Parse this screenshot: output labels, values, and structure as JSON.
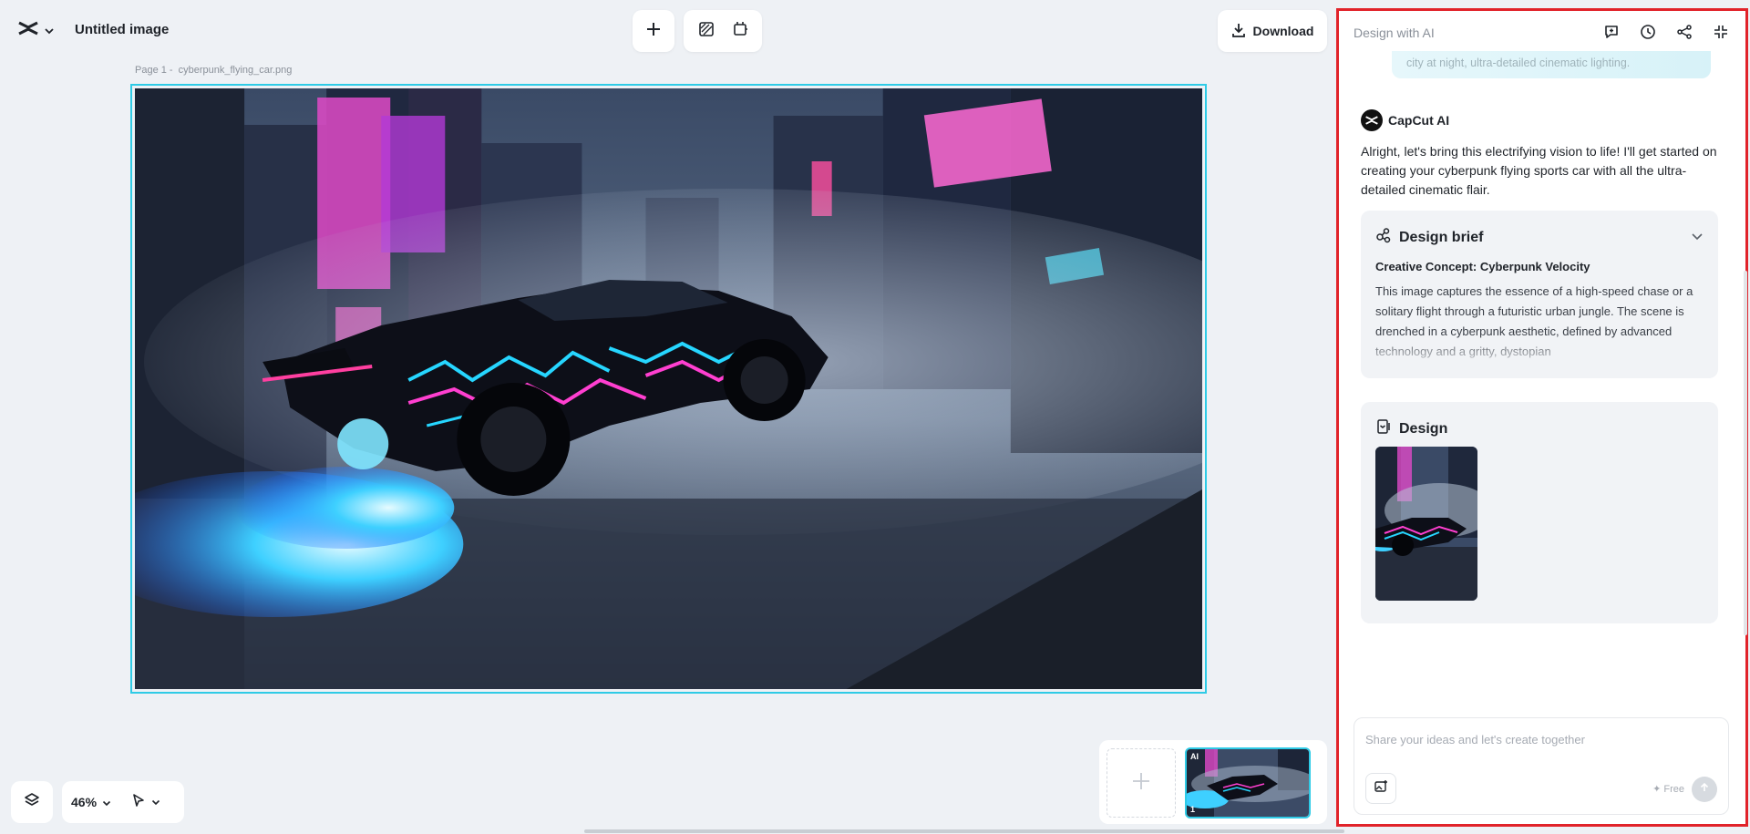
{
  "header": {
    "logo_icon": "capcut-logo-icon",
    "menu_icon": "chevron-down-icon",
    "title": "Untitled image"
  },
  "toolbar": {
    "add_icon": "plus-icon",
    "tool1_icon": "background-remove-icon",
    "tool2_icon": "resize-icon",
    "download_label": "Download",
    "download_icon": "download-icon"
  },
  "canvas": {
    "page_label": "Page 1 -",
    "file_name": "cyberpunk_flying_car.png"
  },
  "bottom_bar": {
    "layers_icon": "layers-icon",
    "zoom": "46%",
    "pointer_icon": "pointer-icon"
  },
  "pages": {
    "add_icon": "plus-icon",
    "ai_badge": "AI",
    "page_number": "1"
  },
  "ai_panel": {
    "title": "Design with AI",
    "icons": [
      "new-chat-icon",
      "history-icon",
      "share-icon",
      "collapse-icon"
    ],
    "user_prompt_tail": "city at night, ultra-detailed cinematic lighting.",
    "assistant_name": "CapCut AI",
    "assistant_message": "Alright, let's bring this electrifying vision to life! I'll get started on creating your cyberpunk flying sports car with all the ultra-detailed cinematic flair.",
    "brief": {
      "title": "Design brief",
      "subtitle": "Creative Concept: Cyberpunk Velocity",
      "text": "This image captures the essence of a high-speed chase or a solitary flight through a futuristic urban jungle. The scene is drenched in a cyberpunk aesthetic, defined by advanced technology and a gritty, dystopian"
    },
    "design": {
      "title": "Design"
    },
    "input": {
      "placeholder": "Share your ideas and let's create together",
      "free_label": "Free"
    }
  },
  "colors": {
    "accent": "#2fcbe6",
    "panel_border": "#e1232a",
    "background": "#eef1f5"
  }
}
